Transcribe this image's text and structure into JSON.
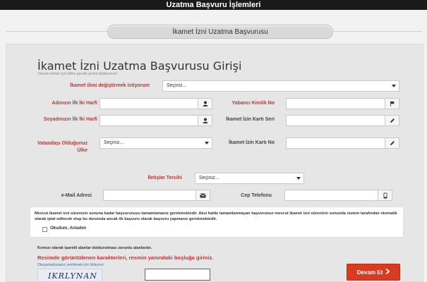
{
  "window": {
    "title": "Uzatma Başvuru İşlemleri"
  },
  "section_pill": "İkamet İzni Uzatma Başvurusu",
  "form": {
    "title": "İkamet İzni Uzatma Başvurusu Girişi",
    "subtitle": "Devam etmek için lütfen gerekli yerleri doldurunuz!",
    "province_label": "İkamet ilimi değiştirmek istiyorum",
    "province_value": "Seçiniz...",
    "name_label": "Adınızın İlk İki Harfi",
    "surname_label": "Soyadınızın İlk İki Harfi",
    "nationality_label": "Vatandaşı Olduğunuz Ülke",
    "nationality_value": "Seçiniz...",
    "foreign_id_label": "Yabancı Kimlik No",
    "permit_serial_label": "İkamet İzin Kartı Seri",
    "permit_no_label": "İkamet İzin Kartı No",
    "contact_label": "İletişim Tercihi",
    "contact_value": "Seçiniz...",
    "email_label": "e-Mail Adresi",
    "phone_label": "Cep Telefonu"
  },
  "notice": {
    "text": "Mevcut ikamet izni sürenizin sonuna kadar başvurunuzu tamamlamanız gerekmektedir. Aksi halde tamamlanmayan başvurunuz mevcut ikamet izni sürenizin sonunda sistem tarafından otomatik olarak iptal edilecek olup bu durumda ancak ilk başvuru olarak başvuru yapmanız gerekmektedir.",
    "checkbox_label": "Okudum, Anladım"
  },
  "required_note": "Kırmızı olarak işaretli alanlar doldurulması zorunlu alanlardır.",
  "captcha": {
    "title": "Resimde görüntülenen karakterleri, resmin yanındaki boşluğa giriniz.",
    "refresh_link": "Okuyamadıysanız yenilemek için tıklayınız",
    "code": "IKRLYNAN"
  },
  "next_button": "Devam Et",
  "colors": {
    "accent_red": "#d93b21",
    "label_red": "#b53a3a",
    "topbar": "#1a1a1a"
  }
}
